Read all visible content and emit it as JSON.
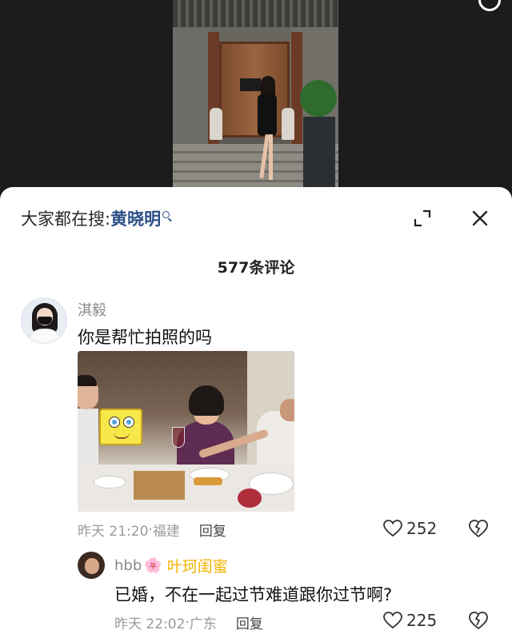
{
  "header": {
    "search_prefix": "大家都在搜:",
    "search_keyword": "黄晓明"
  },
  "comments_header": {
    "count_label": "577条评论"
  },
  "comments": [
    {
      "username": "淇毅",
      "text": "你是帮忙拍照的吗",
      "time": "昨天 21:20",
      "location": "福建",
      "reply_label": "回复",
      "likes": "252",
      "has_image": true
    }
  ],
  "replies": [
    {
      "username": "hbb",
      "emoji": "🌸",
      "tag": "叶珂闺蜜",
      "text": "已婚，不在一起过节难道跟你过节啊?",
      "time": "昨天 22:02",
      "location": "广东",
      "reply_label": "回复",
      "likes": "225"
    }
  ],
  "icons": {
    "expand": "expand-icon",
    "close": "close-icon",
    "like": "heart-icon",
    "dislike": "broken-heart-icon",
    "search": "search-icon"
  },
  "colors": {
    "keyword": "#2c4f86",
    "tag": "#f5b400",
    "muted": "#9a9a9a"
  }
}
